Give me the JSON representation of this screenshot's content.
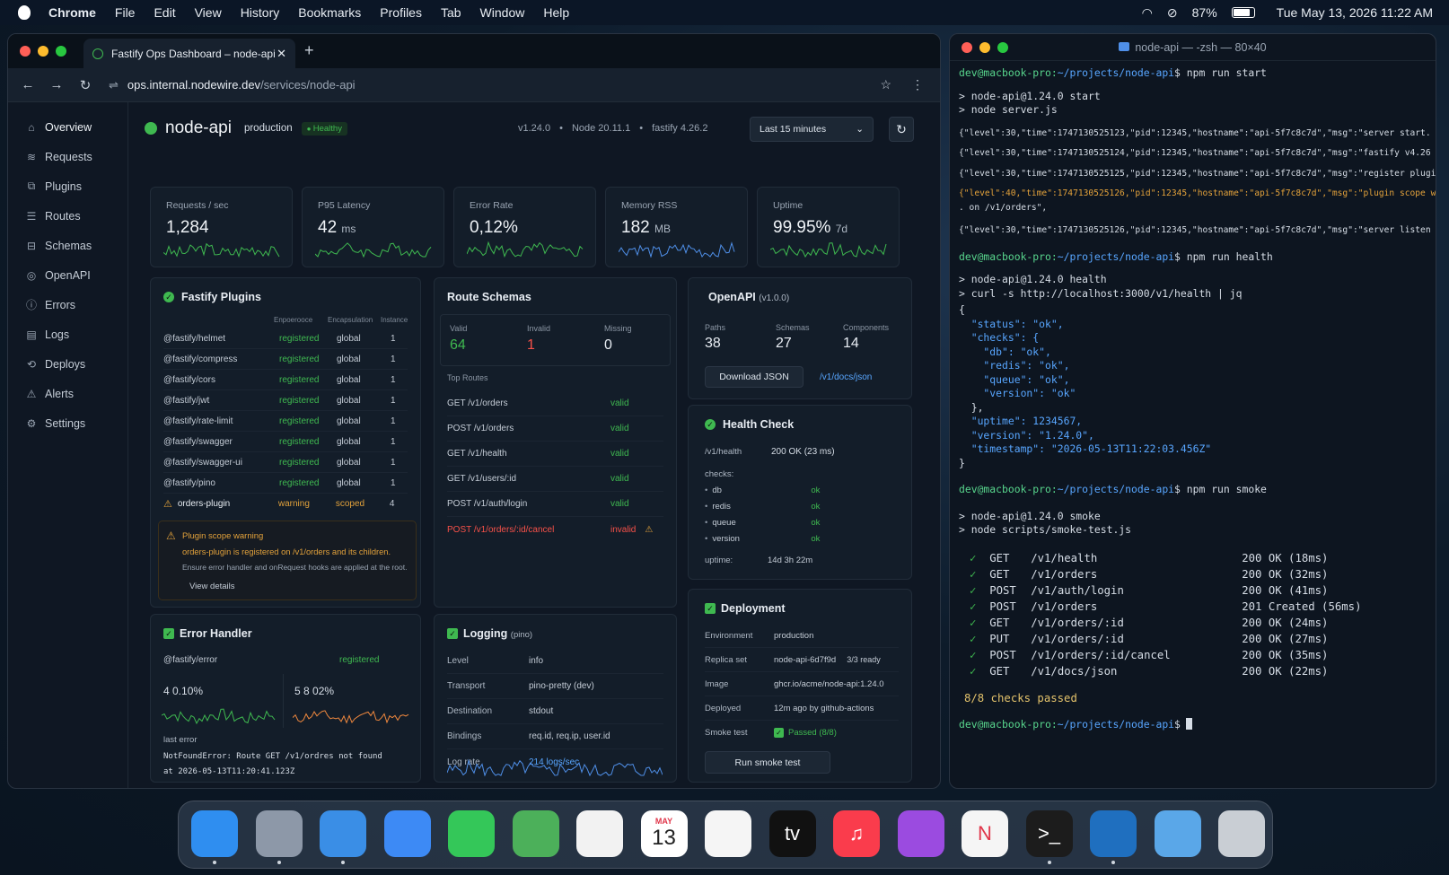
{
  "menubar": {
    "app": "Chrome",
    "items": [
      "File",
      "Edit",
      "View",
      "History",
      "Bookmarks",
      "Profiles",
      "Tab",
      "Window",
      "Help"
    ],
    "battery": "87%",
    "battery_level": 0.87,
    "datetime": "Tue May 13, 2026  11:22 AM"
  },
  "browser": {
    "tab_title": "Fastify Ops Dashboard – node-api",
    "url_host": "ops.internal.nodewire.dev",
    "url_path": "/services/node-api"
  },
  "sidebar": [
    "Overview",
    "Requests",
    "Plugins",
    "Routes",
    "Schemas",
    "OpenAPI",
    "Errors",
    "Logs",
    "Deploys",
    "Alerts",
    "Settings"
  ],
  "header": {
    "service": "node-api",
    "env": "production",
    "status": "Healthy",
    "version": "v1.24.0",
    "node": "Node 20.11.1",
    "fastify": "fastify  4.26.2",
    "range": "Last 15 minutes"
  },
  "kpis": [
    {
      "label": "Requests / sec",
      "value": "1,284",
      "unit": "",
      "color": "#3fb950"
    },
    {
      "label": "P95 Latency",
      "value": "42",
      "unit": "ms",
      "color": "#3fb950"
    },
    {
      "label": "Error Rate",
      "value": "0,12%",
      "unit": "",
      "color": "#3fb950"
    },
    {
      "label": "Memory RSS",
      "value": "182",
      "unit": "MB",
      "color": "#4f8fe8"
    },
    {
      "label": "Uptime",
      "value": "99.95%",
      "unit": "7d",
      "color": "#3fb950"
    }
  ],
  "plugins": {
    "title": "Fastify Plugins",
    "cols": [
      "Enpoerooce",
      "Encapsulation",
      "Instance"
    ],
    "rows": [
      {
        "name": "@fastify/helmet",
        "status": "registered",
        "scope": "global",
        "n": "1"
      },
      {
        "name": "@fastify/compress",
        "status": "registered",
        "scope": "global",
        "n": "1"
      },
      {
        "name": "@fastify/cors",
        "status": "registered",
        "scope": "global",
        "n": "1"
      },
      {
        "name": "@fastify/jwt",
        "status": "registered",
        "scope": "global",
        "n": "1"
      },
      {
        "name": "@fastify/rate-limit",
        "status": "registered",
        "scope": "global",
        "n": "1"
      },
      {
        "name": "@fastify/swagger",
        "status": "registered",
        "scope": "global",
        "n": "1"
      },
      {
        "name": "@fastify/swagger-ui",
        "status": "registered",
        "scope": "global",
        "n": "1"
      },
      {
        "name": "@fastify/pino",
        "status": "registered",
        "scope": "global",
        "n": "1"
      },
      {
        "name": "orders-plugin",
        "status": "warning",
        "scope": "scoped",
        "n": "4"
      }
    ],
    "warning_title": "Plugin scope warning",
    "warning_line1": "orders-plugin is registered on /v1/orders and its children.",
    "warning_line2": "Ensure error handler and onRequest hooks are applied at the root.",
    "details": "View details"
  },
  "routes": {
    "title": "Route Schemas",
    "valid_label": "Valid",
    "valid": "64",
    "invalid_label": "Invalid",
    "invalid": "1",
    "missing_label": "Missing",
    "missing": "0",
    "top_label": "Top Routes",
    "rows": [
      {
        "route": "GET /v1/orders",
        "status": "valid"
      },
      {
        "route": "POST /v1/orders",
        "status": "valid"
      },
      {
        "route": "GET /v1/health",
        "status": "valid"
      },
      {
        "route": "GET /v1/users/:id",
        "status": "valid"
      },
      {
        "route": "POST /v1/auth/login",
        "status": "valid"
      },
      {
        "route": "POST /v1/orders/:id/cancel",
        "status": "invalid"
      }
    ]
  },
  "openapi": {
    "title": "OpenAPI",
    "version": "(v1.0.0)",
    "paths_label": "Paths",
    "paths": "38",
    "schemas_label": "Schemas",
    "schemas": "27",
    "components_label": "Components",
    "components": "14",
    "download": "Download JSON",
    "link": "/v1/docs/json"
  },
  "health": {
    "title": "Health Check",
    "endpoint": "/v1/health",
    "result": "200 OK (23 ms)",
    "checks_label": "checks:",
    "checks": [
      {
        "k": "db",
        "v": "ok"
      },
      {
        "k": "redis",
        "v": "ok"
      },
      {
        "k": "queue",
        "v": "ok"
      },
      {
        "k": "version",
        "v": "ok"
      }
    ],
    "uptime_label": "uptime:",
    "uptime": "14d 3h 22m"
  },
  "deployment": {
    "title": "Deployment",
    "rows": [
      {
        "k": "Environment",
        "v": "production",
        "x": ""
      },
      {
        "k": "Replica set",
        "v": "node-api-6d7f9d",
        "x": "3/3 ready"
      },
      {
        "k": "Image",
        "v": "ghcr.io/acme/node-api:1.24.0",
        "x": ""
      },
      {
        "k": "Deployed",
        "v": "12m ago by github-actions",
        "x": ""
      },
      {
        "k": "Smoke test",
        "v": "Passed (8/8)",
        "x": ""
      }
    ],
    "button": "Run smoke test"
  },
  "error_handler": {
    "title": "Error Handler",
    "plugin": "@fastify/error",
    "status": "registered",
    "m1": "4 0.10%",
    "m2": "5 8 02%",
    "last_error": "last error",
    "e1": "NotFoundError: Route GET /v1/ordres not found",
    "e2": "at 2026-05-13T11:20:41.123Z"
  },
  "logging": {
    "title": "Logging",
    "sub": "(pino)",
    "rows": [
      {
        "k": "Level",
        "v": "info"
      },
      {
        "k": "Transport",
        "v": "pino-pretty (dev)"
      },
      {
        "k": "Destination",
        "v": "stdout"
      },
      {
        "k": "Bindings",
        "v": "req.id, req.ip, user.id"
      },
      {
        "k": "Log rate",
        "v": "214 logs/sec"
      }
    ]
  },
  "terminal": {
    "title": "node-api — -zsh — 80×40",
    "prompt": "dev@macbook-pro:~/projects/node-api$",
    "cmd1": " npm run start",
    "s1": "> node-api@1.24.0 start",
    "s2": "> node server.js",
    "logs": [
      "{\"level\":30,\"time\":1747130525123,\"pid\":12345,\"hostname\":\"api-5f7c8c7d\",\"msg\":\"server start.",
      "{\"level\":30,\"time\":1747130525124,\"pid\":12345,\"hostname\":\"api-5f7c8c7d\",\"msg\":\"fastify v4.26",
      "{\"level\":30,\"time\":1747130525125,\"pid\":12345,\"hostname\":\"api-5f7c8c7d\",\"msg\":\"register plugin",
      "{\"level\":40,\"time\":1747130525126,\"pid\":12345,\"hostname\":\"api-5f7c8c7d\",\"msg\":\"plugin scope w",
      ". on /v1/orders\",",
      "{\"level\":30,\"time\":1747130525126,\"pid\":12345,\"hostname\":\"api-5f7c8c7d\",\"msg\":\"server listen"
    ],
    "cmd2": " npm run health",
    "h1": "> node-api@1.24.0 health",
    "h2": "> curl -s http://localhost:3000/v1/health | jq",
    "json": [
      "{",
      "  \"status\": \"ok\",",
      "  \"checks\": {",
      "    \"db\": \"ok\",",
      "    \"redis\": \"ok\",",
      "    \"queue\": \"ok\",",
      "    \"version\": \"ok\"",
      "  },",
      "  \"uptime\": 1234567,",
      "  \"version\": \"1.24.0\",",
      "  \"timestamp\": \"2026-05-13T11:22:03.456Z\"",
      "}"
    ],
    "cmd3": " npm run smoke",
    "k1": "> node-api@1.24.0 smoke",
    "k2": "> node scripts/smoke-test.js",
    "smoke": [
      {
        "m": "GET ",
        "p": "/v1/health",
        "r": "200 OK (18ms)"
      },
      {
        "m": "GET ",
        "p": "/v1/orders",
        "r": "200 OK (32ms)"
      },
      {
        "m": "POST",
        "p": "/v1/auth/login",
        "r": "200 OK (41ms)"
      },
      {
        "m": "POST",
        "p": "/v1/orders",
        "r": "201 Created (56ms)"
      },
      {
        "m": "GET ",
        "p": "/v1/orders/:id",
        "r": "200 OK (24ms)"
      },
      {
        "m": "PUT ",
        "p": "/v1/orders/:id",
        "r": "200 OK (27ms)"
      },
      {
        "m": "POST",
        "p": "/v1/orders/:id/cancel",
        "r": "200 OK (35ms)"
      },
      {
        "m": "GET ",
        "p": "/v1/docs/json",
        "r": "200 OK (22ms)"
      }
    ],
    "passed": "8/8 checks passed"
  },
  "dock": [
    {
      "name": "finder",
      "label": "",
      "color": "#2f8ef0"
    },
    {
      "name": "launchpad",
      "label": "",
      "color": "#8d98a8"
    },
    {
      "name": "safari",
      "label": "",
      "color": "#3a8ee6"
    },
    {
      "name": "mail",
      "label": "",
      "color": "#3d8af5"
    },
    {
      "name": "messages",
      "label": "",
      "color": "#34c759"
    },
    {
      "name": "maps",
      "label": "",
      "color": "#4cb05a"
    },
    {
      "name": "photos",
      "label": "",
      "color": "#f2f2f2"
    },
    {
      "name": "calendar",
      "label": "13",
      "month": "MAY",
      "color": "#ffffff"
    },
    {
      "name": "reminders",
      "label": "",
      "color": "#f5f5f5"
    },
    {
      "name": "apple-tv",
      "label": "tv",
      "color": "#111111"
    },
    {
      "name": "music",
      "label": "♫",
      "color": "#fa3c4c"
    },
    {
      "name": "podcasts",
      "label": "",
      "color": "#9b4be0"
    },
    {
      "name": "news",
      "label": "N",
      "color": "#f5f5f5"
    },
    {
      "name": "terminal",
      "label": ">_",
      "color": "#1c1c1c"
    },
    {
      "name": "vscode",
      "label": "",
      "color": "#1f6fbf"
    },
    {
      "name": "downloads",
      "label": "",
      "color": "#5aa7e8"
    },
    {
      "name": "trash",
      "label": "",
      "color": "#c9ced4"
    }
  ]
}
